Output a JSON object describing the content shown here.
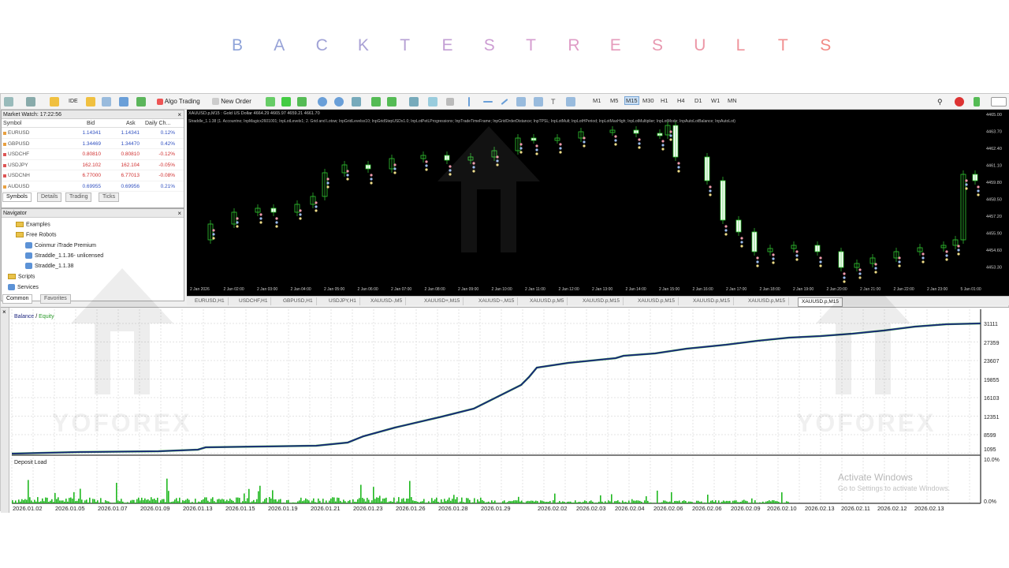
{
  "page": {
    "title_letters": [
      "B",
      "A",
      "C",
      "K",
      "T",
      "E",
      "S",
      "T",
      "R",
      "E",
      "S",
      "U",
      "L",
      "T",
      "S"
    ],
    "title_colors": [
      "#8ea3d9",
      "#97a2d7",
      "#a0a2d6",
      "#a9a1d5",
      "#b6a0d4",
      "#c39fd4",
      "#cd9dd3",
      "#d59ccf",
      "#df9cc6",
      "#e59bbb",
      "#e898b0",
      "#ec97a6",
      "#ef939b",
      "#f18f90",
      "#f28a85"
    ]
  },
  "toolbar": {
    "algo_trading": "Algo Trading",
    "new_order": "New Order",
    "timeframes": [
      "M1",
      "M5",
      "M15",
      "M30",
      "H1",
      "H4",
      "D1",
      "W1",
      "MN"
    ],
    "selected_tf": "M15"
  },
  "market_watch": {
    "title": "Market Watch: 17:22:56",
    "col_symbol": "Symbol",
    "col_bid": "Bid",
    "col_ask": "Ask",
    "col_change": "Daily Ch...",
    "rows": [
      {
        "symbol": "EURUSD",
        "bid": "1.14341",
        "ask": "1.14341",
        "change": "0.12%",
        "neg": false
      },
      {
        "symbol": "GBPUSD",
        "bid": "1.34469",
        "ask": "1.34470",
        "change": "0.42%",
        "neg": false
      },
      {
        "symbol": "USDCHF",
        "bid": "0.80810",
        "ask": "0.80810",
        "change": "-0.12%",
        "neg": true
      },
      {
        "symbol": "USDJPY",
        "bid": "162.102",
        "ask": "162.104",
        "change": "-0.05%",
        "neg": true
      },
      {
        "symbol": "USDCNH",
        "bid": "6.77000",
        "ask": "6.77013",
        "change": "-0.08%",
        "neg": true
      },
      {
        "symbol": "AUDUSD",
        "bid": "0.69955",
        "ask": "0.69956",
        "change": "0.21%",
        "neg": false
      }
    ],
    "tabs": [
      "Symbols",
      "Details",
      "Trading",
      "Ticks"
    ]
  },
  "navigator": {
    "title": "Navigator",
    "items": [
      "Examples",
      "Free Robots",
      "Coinmur iTrade Premium",
      "Straddle_1.1.36- unlicensed",
      "Straddle_1.1.38",
      "Scripts",
      "Services"
    ],
    "tabs": [
      "Common",
      "Favorites"
    ]
  },
  "chart": {
    "title": "XAUUSD.p,M15 : Gold US Dollar  4664.29 4665.97 4659.21 4661.70",
    "info": "Straddle_1.1.38 (1. Accountno; InpMagicx2601001; InpLotLevelx1; 2. Grid and Lotsw; InpGridLevelsx10; InpGridStepUSDx1.0; InpLotPetLProgressionx; InpTradeTimeFrame; InpGridOrderDistance; InpTPSL; InpLotMult; InpLotHPeriod; InpLotMaxHigh; InpLotMultiplier; InpLotMode; InpAutoLotBalance; InpAutoLot)",
    "price_labels": [
      "4465.00",
      "4463.70",
      "4462.40",
      "4461.10",
      "4459.80",
      "4458.50",
      "4457.20",
      "4455.90",
      "4454.60",
      "4453.30"
    ],
    "time_labels": [
      "2 Jan 2026",
      "2 Jan 02:00",
      "2 Jan 03:00",
      "2 Jan 04:00",
      "2 Jan 05:00",
      "2 Jan 06:00",
      "2 Jan 07:00",
      "2 Jan 08:00",
      "2 Jan 09:00",
      "2 Jan 10:00",
      "2 Jan 11:00",
      "2 Jan 12:00",
      "2 Jan 13:00",
      "2 Jan 14:00",
      "2 Jan 15:00",
      "2 Jan 16:00",
      "2 Jan 17:00",
      "2 Jan 18:00",
      "2 Jan 19:00",
      "2 Jan 20:00",
      "2 Jan 21:00",
      "2 Jan 22:00",
      "2 Jan 23:00",
      "5 Jan 01:00"
    ]
  },
  "chart_tabs": [
    "EURUSD,H1",
    "USDCHF,H1",
    "GBPUSD,H1",
    "USDJPY,H1",
    "XAUUSD-,M5",
    "XAUUSD+,M15",
    "XAUUSD~,M15",
    "XAUUSD.p,M5",
    "XAUUSD.p,M15",
    "XAUUSD.p,M15",
    "XAUUSD.p,M15",
    "XAUUSD.p,M15",
    "XAUUSD.p,M15"
  ],
  "tester": {
    "balance": "Balance",
    "equity": "Equity",
    "separator": "/",
    "deposit_load": "Deposit Load",
    "y_labels": [
      "31111",
      "27359",
      "23607",
      "19855",
      "16103",
      "12351",
      "8599",
      "1095"
    ],
    "load_labels": [
      "10.0%",
      "0.0%"
    ],
    "x_labels": [
      "2026.01.02",
      "2026.01.05",
      "2026.01.07",
      "2026.01.09",
      "2026.01.13",
      "2026.01.15",
      "2026.01.19",
      "2026.01.21",
      "2026.01.23",
      "2026.01.26",
      "2026.01.28",
      "2026.01.29",
      "2026.02.02",
      "2026.02.03",
      "2026.02.04",
      "2026.02.06",
      "2026.02.06",
      "2026.02.09",
      "2026.02.10",
      "2026.02.13",
      "2026.02.11",
      "2026.02.12",
      "2026.02.13"
    ],
    "balance_color": "#1a237e",
    "equity_color": "#3cb043",
    "load_color": "#1fb81f"
  },
  "watermarks": {
    "text": "YOFOREX"
  },
  "windows": {
    "activate": "Activate Windows",
    "goto": "Go to Settings to activate Windows."
  }
}
